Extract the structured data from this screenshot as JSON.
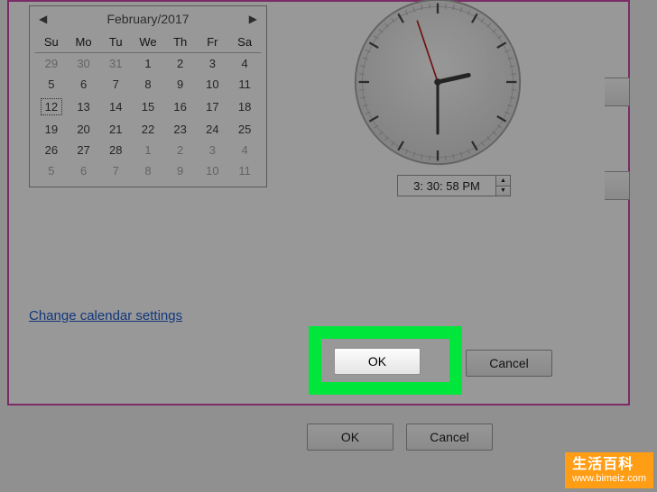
{
  "calendar": {
    "title": "February/2017",
    "prev": "◀",
    "next": "▶",
    "dow": [
      "Su",
      "Mo",
      "Tu",
      "We",
      "Th",
      "Fr",
      "Sa"
    ],
    "rows": [
      [
        {
          "d": "29",
          "o": true
        },
        {
          "d": "30",
          "o": true
        },
        {
          "d": "31",
          "o": true
        },
        {
          "d": "1"
        },
        {
          "d": "2"
        },
        {
          "d": "3"
        },
        {
          "d": "4"
        }
      ],
      [
        {
          "d": "5"
        },
        {
          "d": "6"
        },
        {
          "d": "7"
        },
        {
          "d": "8"
        },
        {
          "d": "9"
        },
        {
          "d": "10"
        },
        {
          "d": "11"
        }
      ],
      [
        {
          "d": "12",
          "sel": true
        },
        {
          "d": "13"
        },
        {
          "d": "14"
        },
        {
          "d": "15"
        },
        {
          "d": "16"
        },
        {
          "d": "17"
        },
        {
          "d": "18"
        }
      ],
      [
        {
          "d": "19"
        },
        {
          "d": "20"
        },
        {
          "d": "21"
        },
        {
          "d": "22"
        },
        {
          "d": "23"
        },
        {
          "d": "24"
        },
        {
          "d": "25"
        }
      ],
      [
        {
          "d": "26"
        },
        {
          "d": "27"
        },
        {
          "d": "28"
        },
        {
          "d": "1",
          "o": true
        },
        {
          "d": "2",
          "o": true
        },
        {
          "d": "3",
          "o": true
        },
        {
          "d": "4",
          "o": true
        }
      ],
      [
        {
          "d": "5",
          "o": true
        },
        {
          "d": "6",
          "o": true
        },
        {
          "d": "7",
          "o": true
        },
        {
          "d": "8",
          "o": true
        },
        {
          "d": "9",
          "o": true
        },
        {
          "d": "10",
          "o": true
        },
        {
          "d": "11",
          "o": true
        }
      ]
    ]
  },
  "time": {
    "value": "3: 30: 58 PM",
    "up": "▲",
    "down": "▼"
  },
  "link": "Change calendar settings",
  "buttons": {
    "dialog_ok": "OK",
    "dialog_cancel": "Cancel",
    "outer_ok": "OK",
    "outer_cancel": "Cancel"
  },
  "watermark": {
    "title": "生活百科",
    "url": "www.bimeiz.com"
  }
}
